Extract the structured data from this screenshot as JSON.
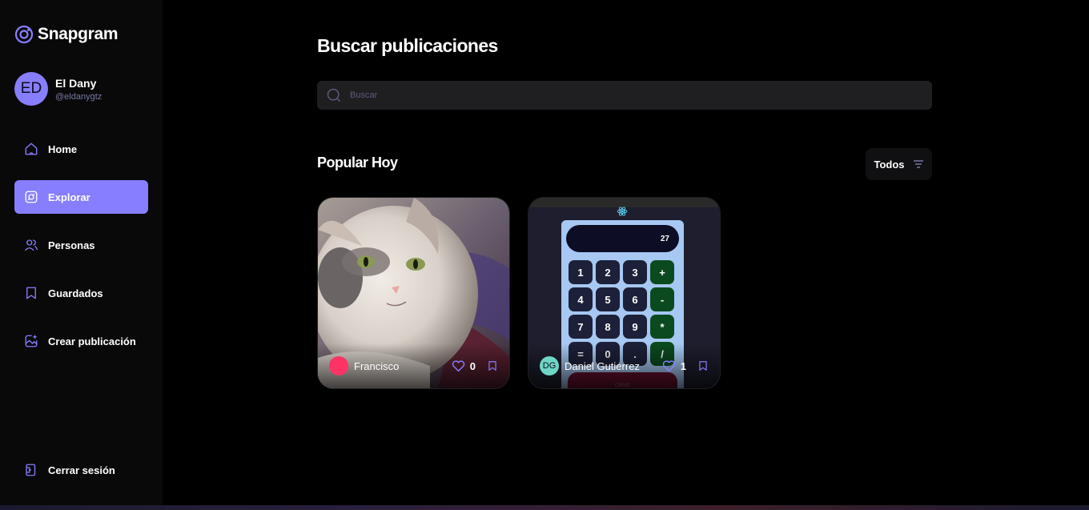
{
  "app": {
    "name": "Snapgram"
  },
  "user": {
    "initials": "ED",
    "name": "El Dany",
    "handle": "@eldanygtz",
    "avatar_color": "#877eff"
  },
  "nav": {
    "items": [
      {
        "label": "Home",
        "icon": "home-icon"
      },
      {
        "label": "Explorar",
        "icon": "explore-icon",
        "active": true
      },
      {
        "label": "Personas",
        "icon": "people-icon"
      },
      {
        "label": "Guardados",
        "icon": "bookmark-icon"
      },
      {
        "label": "Crear publicación",
        "icon": "create-post-icon"
      }
    ],
    "logout_label": "Cerrar sesión"
  },
  "explore": {
    "title": "Buscar publicaciones",
    "search_placeholder": "Buscar",
    "section_title": "Popular Hoy",
    "filter_label": "Todos"
  },
  "posts": [
    {
      "author": "Francisco",
      "author_initials": "",
      "avatar_color": "#ff3366",
      "likes": "0",
      "image": "cat-photo"
    },
    {
      "author": "Daniel Gutierrez",
      "author_initials": "DG",
      "avatar_color": "#6fd6c6",
      "likes": "1",
      "image": "calculator-screenshot",
      "calculator": {
        "display": "27",
        "keys": [
          "1",
          "2",
          "3",
          "+",
          "4",
          "5",
          "6",
          "-",
          "7",
          "8",
          "9",
          "*",
          "=",
          "0",
          ".",
          "/"
        ],
        "clear_label": "clear"
      }
    }
  ],
  "colors": {
    "accent": "#877eff",
    "background": "#000000",
    "sidebar": "#09090a",
    "input": "#1f1f22"
  }
}
